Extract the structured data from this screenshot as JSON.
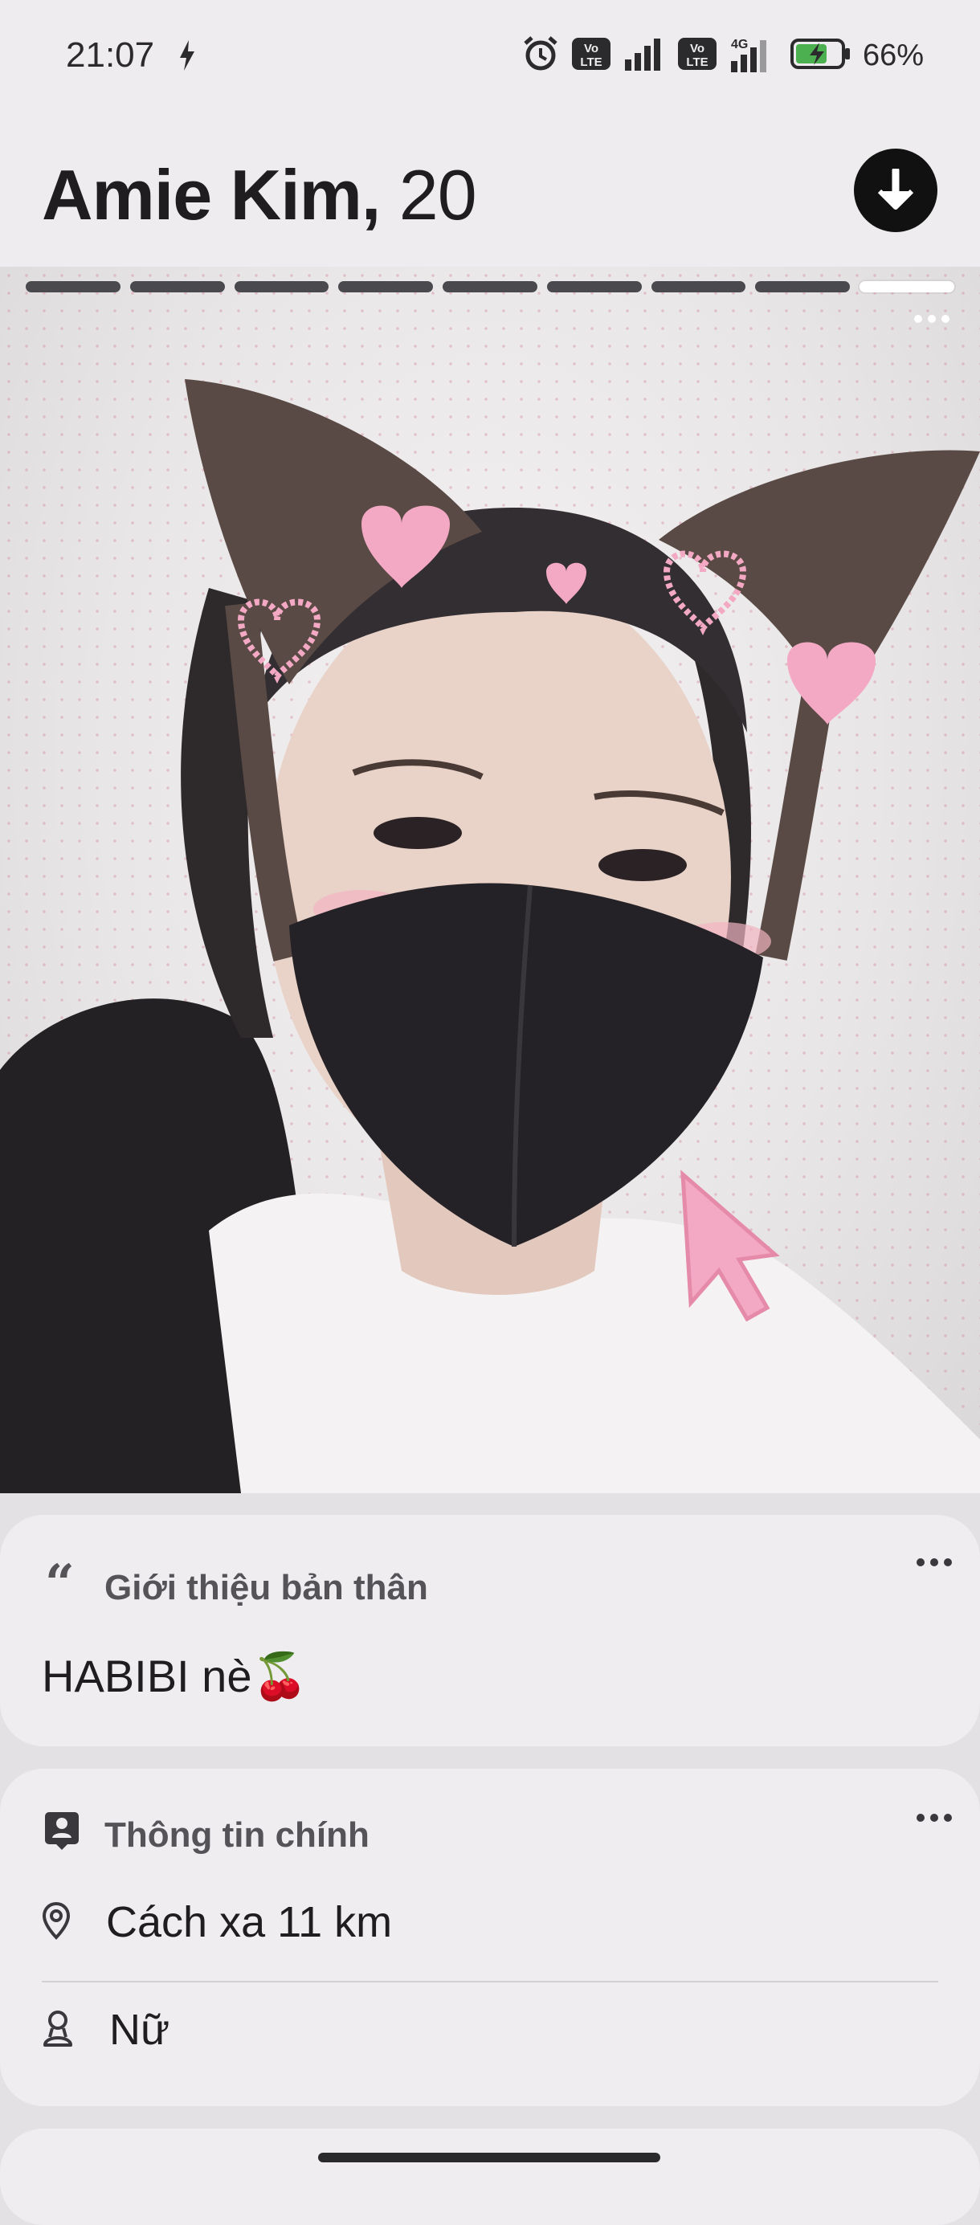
{
  "status_bar": {
    "time": "21:07",
    "network": "4G",
    "volte_1": "Vo LTE",
    "volte_2": "Vo LTE",
    "battery": "66%",
    "icons": [
      "charging-bolt-icon",
      "alarm-icon",
      "volte-icon",
      "signal-icon",
      "volte-icon",
      "signal-4g-icon",
      "battery-charging-icon"
    ]
  },
  "profile": {
    "name": "Amie Kim,",
    "age": "20"
  },
  "photo": {
    "total_photos": 9,
    "current_index": 9,
    "description_icon": "more-horizontal-icon"
  },
  "bio_card": {
    "title": "Giới thiệu bản thân",
    "text": "HABIBI nè🍒"
  },
  "info_card": {
    "title": "Thông tin chính",
    "distance": "Cách xa 11 km",
    "gender": "Nữ"
  },
  "colors": {
    "background": "#e3e1e4",
    "card": "#efedf0",
    "accent_dark": "#111111"
  }
}
